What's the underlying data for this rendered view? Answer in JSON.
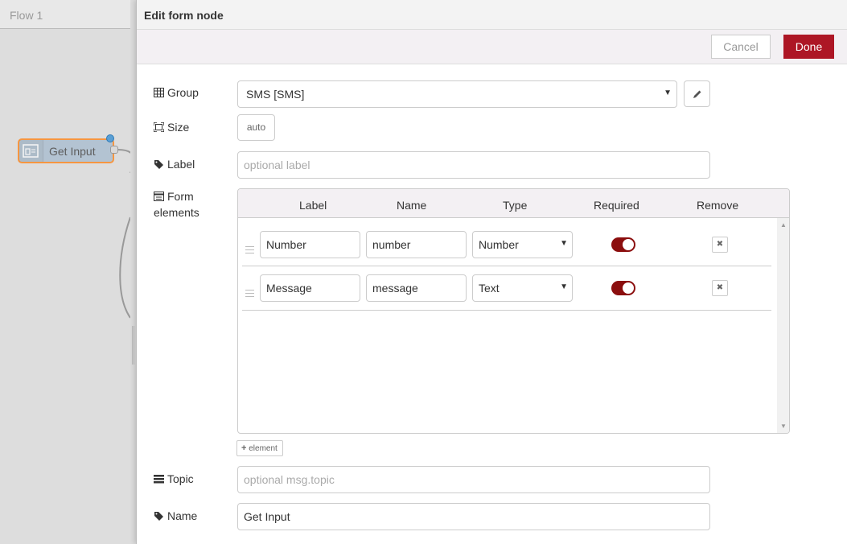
{
  "workspace": {
    "flow_tab": "Flow 1",
    "node_label": "Get Input"
  },
  "tray": {
    "title": "Edit form node",
    "cancel_label": "Cancel",
    "done_label": "Done"
  },
  "fields": {
    "group_label": "Group",
    "group_value": "SMS [SMS]",
    "size_label": "Size",
    "size_value": "auto",
    "label_label": "Label",
    "label_placeholder": "optional label",
    "form_elements_label_1": "Form",
    "form_elements_label_2": "elements",
    "topic_label": "Topic",
    "topic_placeholder": "optional msg.topic",
    "name_label": "Name",
    "name_value": "Get Input"
  },
  "form_table": {
    "headers": [
      "Label",
      "Name",
      "Type",
      "Required",
      "Remove"
    ],
    "rows": [
      {
        "label": "Number",
        "name": "number",
        "type": "Number",
        "required": true
      },
      {
        "label": "Message",
        "name": "message",
        "type": "Text",
        "required": true
      }
    ],
    "remove_glyph": "✖",
    "add_label": "element"
  },
  "colors": {
    "accent": "#ad1625",
    "toggle_on": "#8b0e0e",
    "node_fill": "#a6bbcf",
    "node_border": "#ff7f0e"
  }
}
